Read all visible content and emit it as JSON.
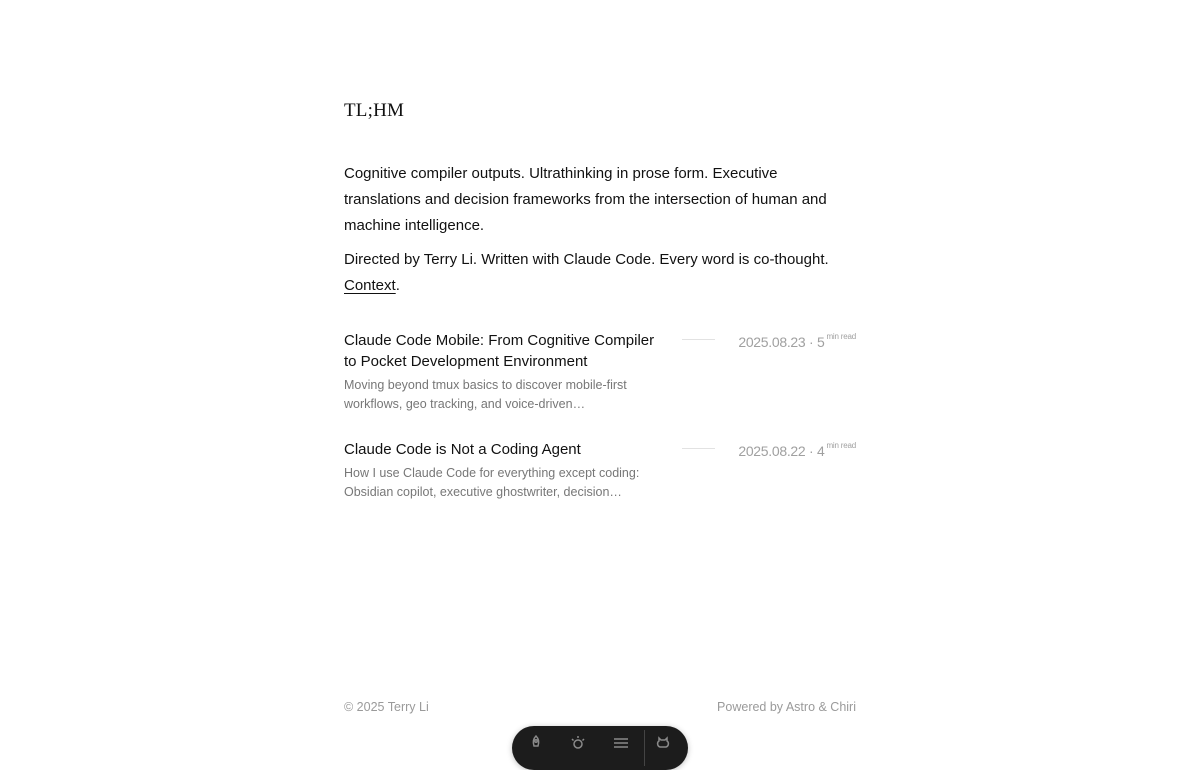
{
  "site": {
    "title": "TL;HM"
  },
  "intro": {
    "paragraph1": "Cognitive compiler outputs. Ultrathinking in prose form. Executive translations and decision frameworks from the intersection of human and machine intelligence.",
    "paragraph2_prefix": "Directed by Terry Li. Written with Claude Code. Every word is co-thought.",
    "context_link": "Context",
    "paragraph2_suffix": "."
  },
  "posts": [
    {
      "title": "Claude Code Mobile: From Cognitive Compiler to Pocket Development Environment",
      "excerpt": "Moving beyond tmux basics to discover mobile-first workflows, geo tracking, and voice-driven…",
      "date": "2025.08.23",
      "separator": "·",
      "read_minutes": "5",
      "read_unit": "min read"
    },
    {
      "title": "Claude Code is Not a Coding Agent",
      "excerpt": "How I use Claude Code for everything except coding: Obsidian copilot, executive ghostwriter, decision…",
      "date": "2025.08.22",
      "separator": "·",
      "read_minutes": "4",
      "read_unit": "min read"
    }
  ],
  "footer": {
    "copyright": "© 2025 Terry Li",
    "powered_by": "Powered by Astro & Chiri"
  },
  "dock": {
    "icons": [
      "rocket-icon",
      "theme-icon",
      "menu-icon",
      "github-icon"
    ]
  },
  "colors": {
    "text": "#111111",
    "muted": "#777777",
    "meta": "#a0a0a0",
    "dock": "#1c1c1c"
  }
}
